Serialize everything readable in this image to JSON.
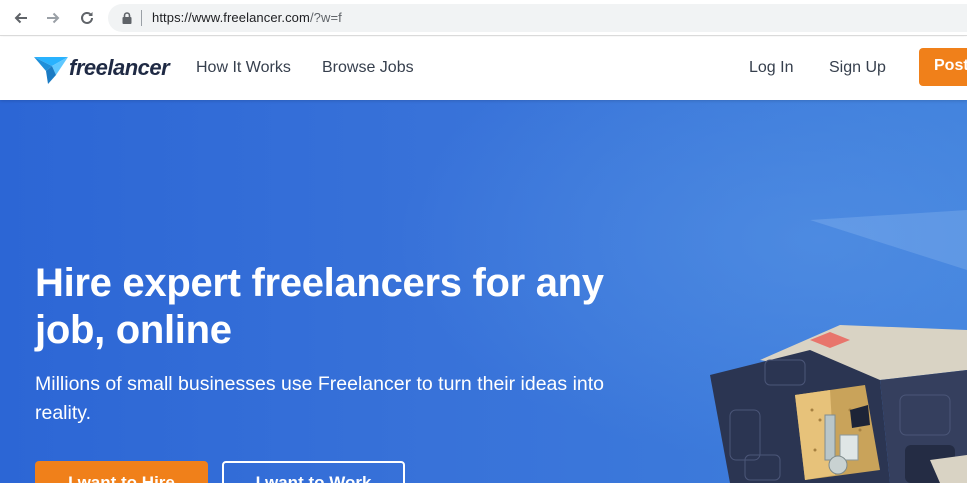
{
  "browser": {
    "url_main": "https://www.freelancer.com",
    "url_rest": "/?w=f"
  },
  "header": {
    "logo_text": "freelancer",
    "nav": {
      "how_it_works": "How It Works",
      "browse_jobs": "Browse Jobs"
    },
    "log_in": "Log In",
    "sign_up": "Sign Up",
    "post": "Post"
  },
  "hero": {
    "title": "Hire expert freelancers for any job, online",
    "subtitle": "Millions of small businesses use Freelancer to turn their ideas into reality.",
    "cta_primary": "I want to Hire",
    "cta_secondary": "I want to Work"
  },
  "colors": {
    "brand_blue": "#29b2fe",
    "hero_blue": "#3872d9",
    "accent_orange": "#f0801a",
    "nav_text": "#363f4d"
  },
  "icons": {
    "back": "back-arrow-icon",
    "forward": "forward-arrow-icon",
    "reload": "reload-icon",
    "lock": "lock-icon",
    "logo": "freelancer-bird-icon"
  }
}
